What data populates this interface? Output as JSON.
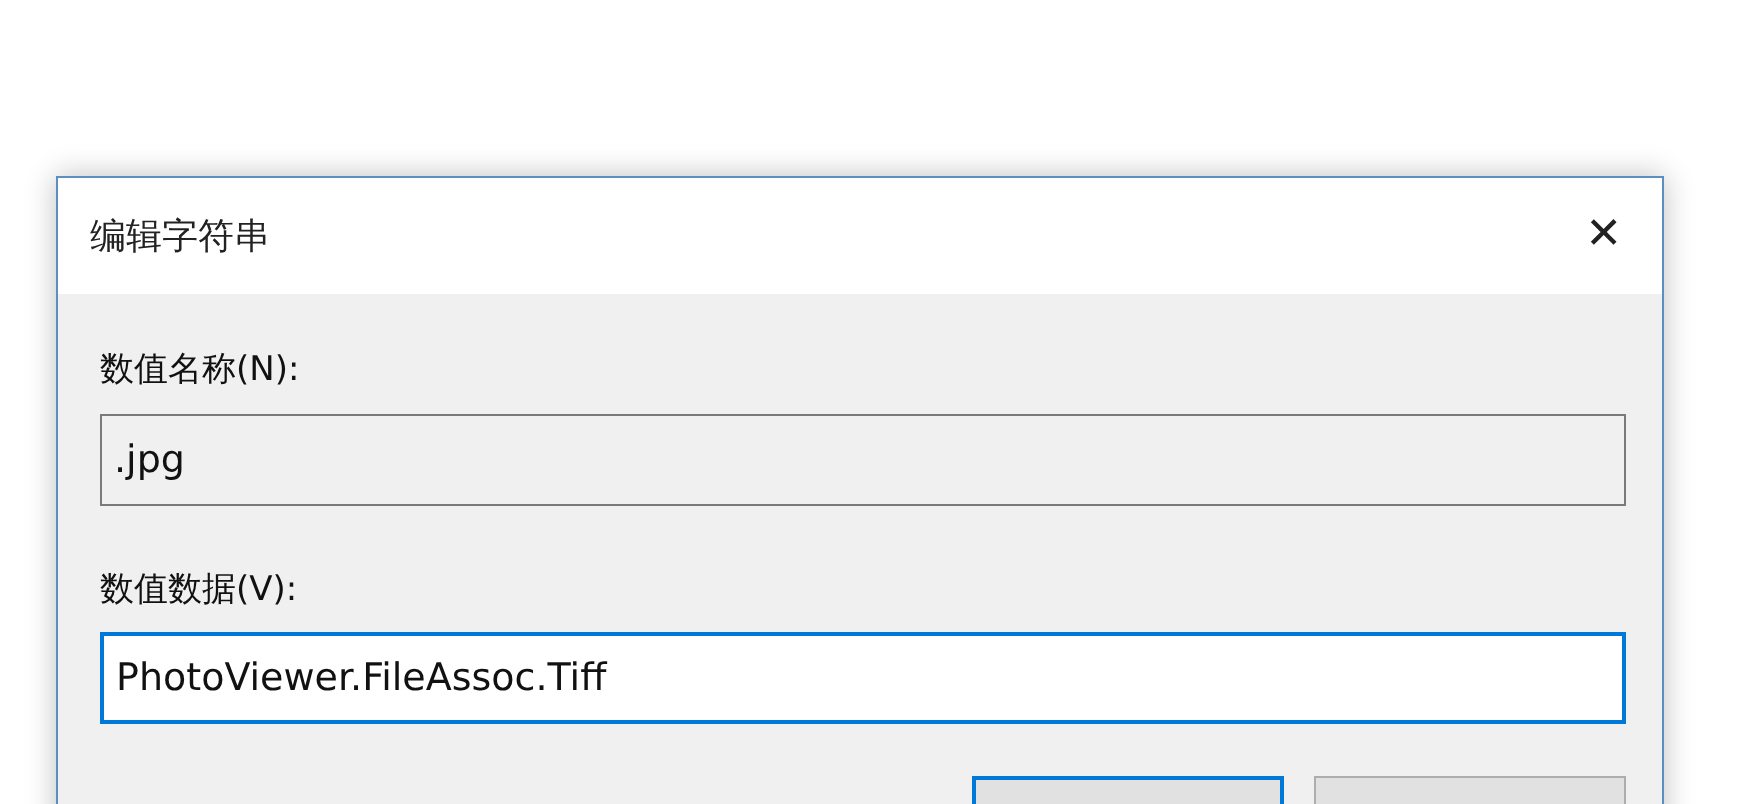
{
  "window": {
    "title": "编辑字符串",
    "close": "✕"
  },
  "fields": [
    {
      "label": "数值名称(N):",
      "value": ".jpg",
      "disabled": true,
      "focused": false
    },
    {
      "label": "数值数据(V):",
      "value": "PhotoViewer.FileAssoc.Tiff",
      "disabled": false,
      "focused": true
    }
  ],
  "buttons": [
    {
      "default": true
    },
    {
      "default": false
    }
  ]
}
